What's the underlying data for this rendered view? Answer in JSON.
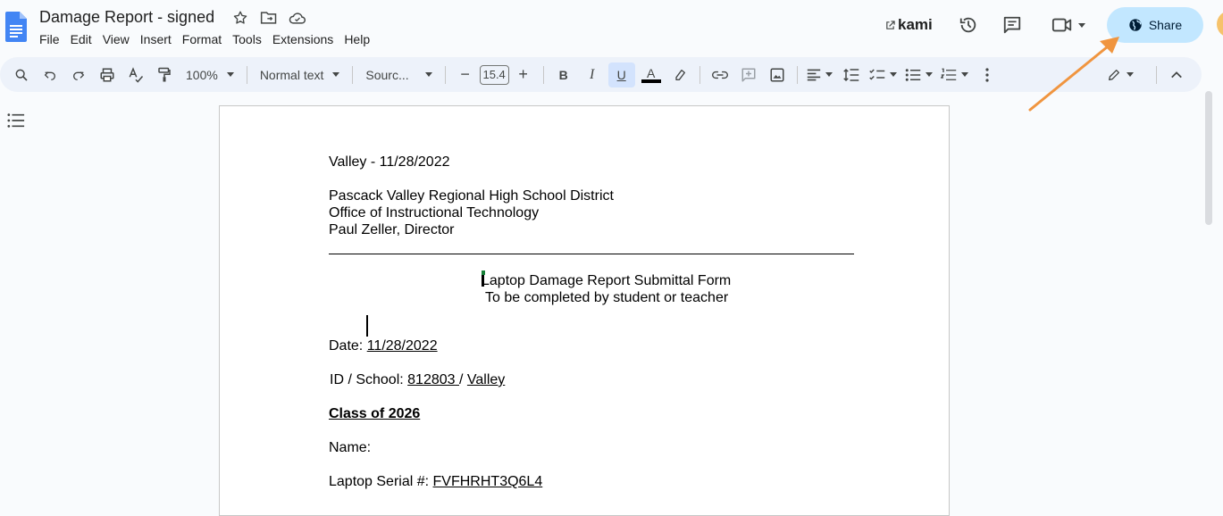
{
  "app": {
    "doc_title": "Damage Report - signed",
    "menu": [
      "File",
      "Edit",
      "View",
      "Insert",
      "Format",
      "Tools",
      "Extensions",
      "Help"
    ],
    "kami_label": "kami",
    "share_label": "Share"
  },
  "toolbar": {
    "zoom": "100%",
    "style": "Normal text",
    "font": "Sourc...",
    "font_size": "15.4",
    "bold": "B",
    "italic": "I",
    "underline": "U",
    "text_color": "A"
  },
  "document": {
    "header_line": "Valley - 11/28/2022",
    "org_line1": "Pascack Valley Regional High School District",
    "org_line2": "Office of Instructional Technology",
    "org_line3": "Paul Zeller, Director",
    "form_title": "Laptop Damage Report Submittal Form",
    "form_subtitle": "To be completed by student or teacher",
    "date_label": "Date:",
    "date_value": "11/28/2022",
    "id_label": "ID / School:",
    "id_value": "812803",
    "id_sep": "/",
    "school_value": "Valley",
    "class_label": "Class of 2026",
    "name_label": "Name:",
    "serial_label": "Laptop Serial #:",
    "serial_value": "FVFHRHT3Q6L4"
  },
  "colors": {
    "share_bg": "#c2e7ff",
    "toolbar_bg": "#edf2fa",
    "arrow": "#f0953f",
    "doc_icon": "#4285f4"
  },
  "icons": [
    "docs-icon",
    "star-icon",
    "move-folder-icon",
    "cloud-saved-icon",
    "history-icon",
    "comment-icon",
    "meet-icon",
    "globe-icon",
    "search-icon",
    "undo-icon",
    "redo-icon",
    "print-icon",
    "spellcheck-icon",
    "paint-format-icon",
    "link-icon",
    "add-comment-icon",
    "image-icon",
    "align-icon",
    "line-spacing-icon",
    "checklist-icon",
    "bullet-list-icon",
    "numbered-list-icon",
    "more-icon",
    "edit-mode-icon",
    "collapse-icon",
    "outline-icon"
  ]
}
